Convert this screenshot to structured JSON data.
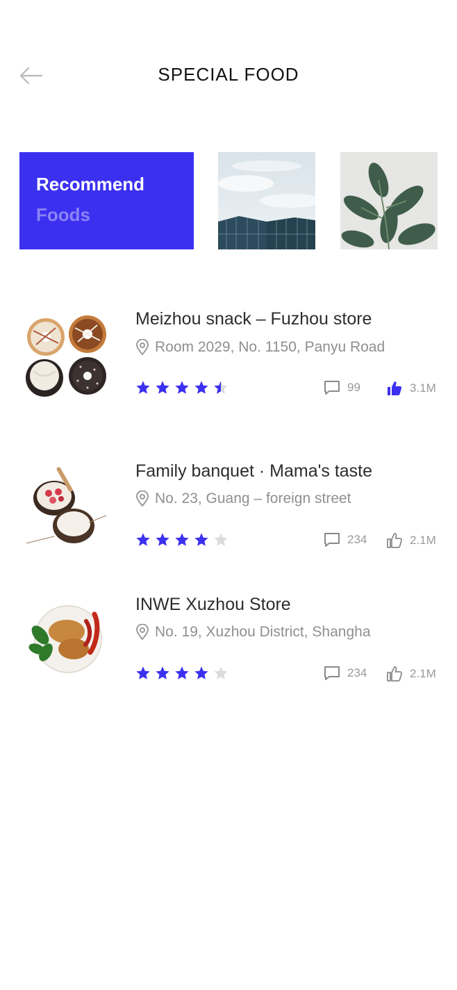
{
  "header": {
    "title": "SPECIAL FOOD"
  },
  "hero": {
    "line1": "Recommend",
    "line2": "Foods"
  },
  "colors": {
    "accent": "#3b30f0",
    "accent_light": "#8a84f6",
    "muted": "#9a9a9a"
  },
  "restaurants": [
    {
      "name": "Meizhou snack – Fuzhou store",
      "address": "Room 2029, No. 1150, Panyu Road",
      "rating": 4.5,
      "comments": "99",
      "likes": "3.1M",
      "liked": true,
      "image": "donuts"
    },
    {
      "name": "Family banquet · Mama's taste",
      "address": "No. 23, Guang – foreign street",
      "rating": 4,
      "comments": "234",
      "likes": "2.1M",
      "liked": false,
      "image": "coconut-bowl"
    },
    {
      "name": "INWE Xuzhou Store",
      "address": "No. 19, Xuzhou District, Shangha",
      "rating": 4,
      "comments": "234",
      "likes": "2.1M",
      "liked": false,
      "image": "fried-chicken-plate"
    }
  ]
}
